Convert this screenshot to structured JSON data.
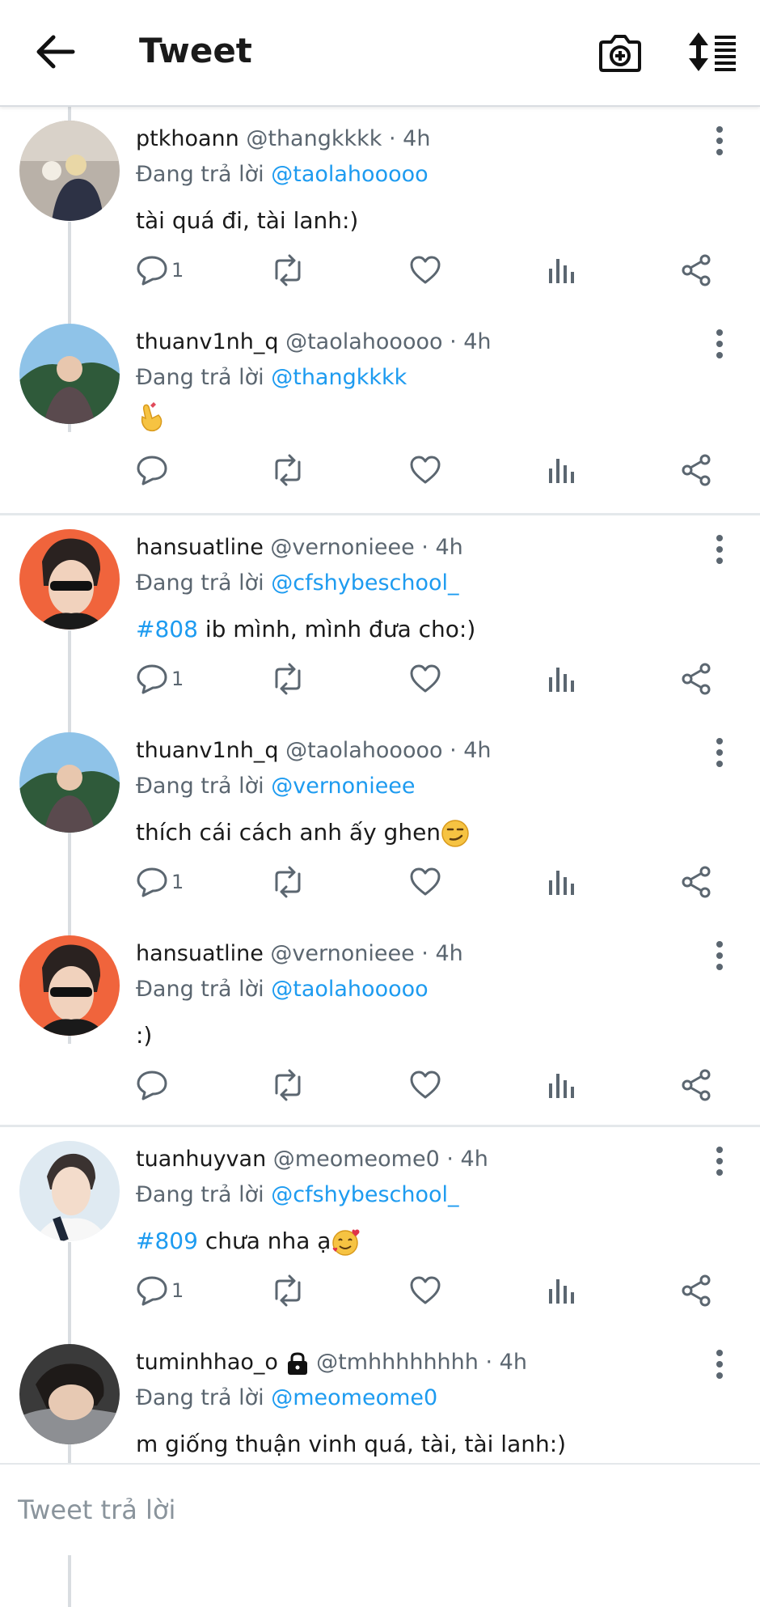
{
  "header": {
    "title": "Tweet"
  },
  "threads": [
    {
      "tweets": [
        {
          "username": "ptkhoann",
          "handle": "@thangkkkk",
          "time": "· 4h",
          "reply_prefix": "Đang trả lời",
          "reply_to": "@taolahooooo",
          "text": "tài quá đi, tài lanh:)",
          "reply_count": "1"
        },
        {
          "username": "thuanv1nh_q",
          "handle": "@taolahooooo",
          "time": "· 4h",
          "reply_prefix": "Đang trả lời",
          "reply_to": "@thangkkkk",
          "text": "",
          "reply_count": ""
        }
      ]
    },
    {
      "tweets": [
        {
          "username": "hansuatline",
          "handle": "@vernonieee",
          "time": "· 4h",
          "reply_prefix": "Đang trả lời",
          "reply_to": "@cfshybeschool_",
          "hashtag": "#808",
          "text": "ib mình, mình đưa cho:)",
          "reply_count": "1"
        },
        {
          "username": "thuanv1nh_q",
          "handle": "@taolahooooo",
          "time": "· 4h",
          "reply_prefix": "Đang trả lời",
          "reply_to": "@vernonieee",
          "text": "thích cái cách anh ấy ghen",
          "reply_count": "1"
        },
        {
          "username": "hansuatline",
          "handle": "@vernonieee",
          "time": "· 4h",
          "reply_prefix": "Đang trả lời",
          "reply_to": "@taolahooooo",
          "text": ":)",
          "reply_count": ""
        }
      ]
    },
    {
      "tweets": [
        {
          "username": "tuanhuyvan",
          "handle": "@meomeome0",
          "time": "· 4h",
          "reply_prefix": "Đang trả lời",
          "reply_to": "@cfshybeschool_",
          "hashtag": "#809",
          "text": "chưa nha ạ",
          "reply_count": "1"
        },
        {
          "username": "tuminhhao_o",
          "handle": "@tmhhhhhhhh",
          "time": "· 4h",
          "reply_prefix": "Đang trả lời",
          "reply_to": "@meomeome0",
          "text": "m giống thuận vinh quá, tài, tài lanh:)",
          "reply_count": ""
        }
      ]
    }
  ],
  "reply_bar": {
    "placeholder": "Tweet trả lời"
  },
  "colors": {
    "accent": "#1d9bf0",
    "muted": "#5b6670",
    "divider": "#e4e8eb"
  }
}
